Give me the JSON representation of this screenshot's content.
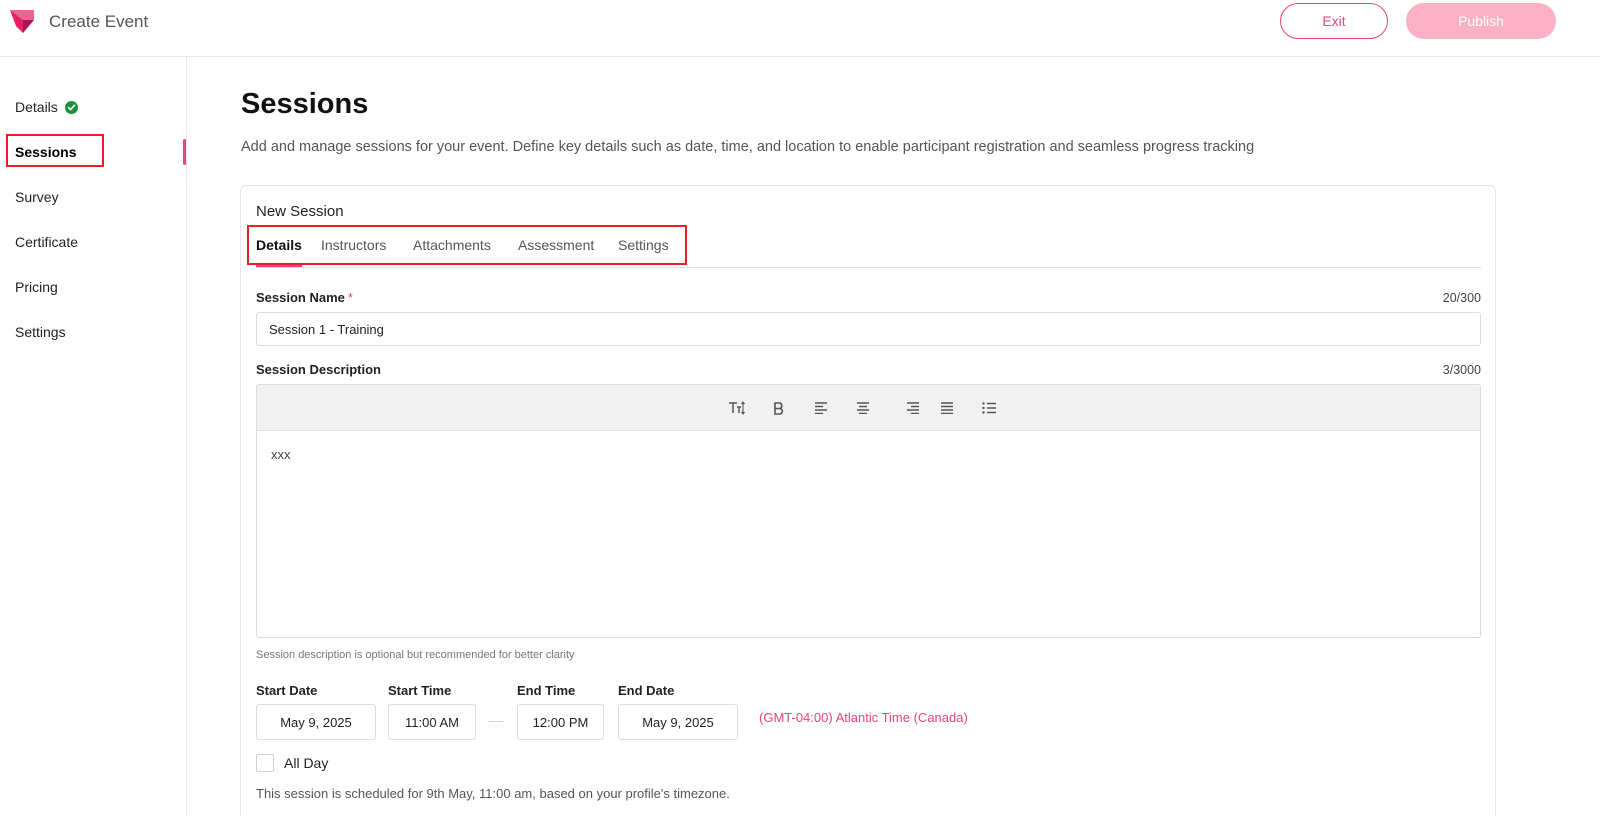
{
  "header": {
    "title": "Create Event",
    "exit_label": "Exit",
    "publish_label": "Publish"
  },
  "colors": {
    "accent": "#e8457a",
    "publish_disabled": "#fbb1c5",
    "success": "#1e8e3e",
    "highlight_box": "#e02424"
  },
  "sidebar": {
    "items": [
      {
        "label": "Details",
        "completed": true
      },
      {
        "label": "Sessions",
        "active": true
      },
      {
        "label": "Survey"
      },
      {
        "label": "Certificate"
      },
      {
        "label": "Pricing"
      },
      {
        "label": "Settings"
      }
    ]
  },
  "main": {
    "title": "Sessions",
    "description": "Add and manage sessions for your event. Define key details such as date, time, and location to enable participant registration and seamless progress tracking"
  },
  "card": {
    "title": "New Session",
    "tabs": [
      {
        "label": "Details",
        "active": true
      },
      {
        "label": "Instructors"
      },
      {
        "label": "Attachments"
      },
      {
        "label": "Assessment"
      },
      {
        "label": "Settings"
      }
    ],
    "session_name": {
      "label": "Session Name",
      "required_mark": "*",
      "counter": "20/300",
      "value": "Session 1 - Training"
    },
    "session_description": {
      "label": "Session Description",
      "counter": "3/3000",
      "value": "xxx",
      "hint": "Session description is optional but recommended for better clarity",
      "toolbar": [
        "text-size-icon",
        "bold-icon",
        "align-left-icon",
        "align-center-icon",
        "align-right-icon",
        "align-justify-icon",
        "list-icon"
      ]
    },
    "schedule": {
      "start_date_label": "Start Date",
      "start_date": "May 9, 2025",
      "start_time_label": "Start Time",
      "start_time": "11:00 AM",
      "end_time_label": "End Time",
      "end_time": "12:00 PM",
      "end_date_label": "End Date",
      "end_date": "May 9, 2025",
      "timezone": "(GMT-04:00) Atlantic Time (Canada)",
      "all_day_label": "All Day",
      "all_day_checked": false,
      "note": "This session is scheduled for 9th May, 11:00 am, based on your profile's timezone."
    }
  }
}
